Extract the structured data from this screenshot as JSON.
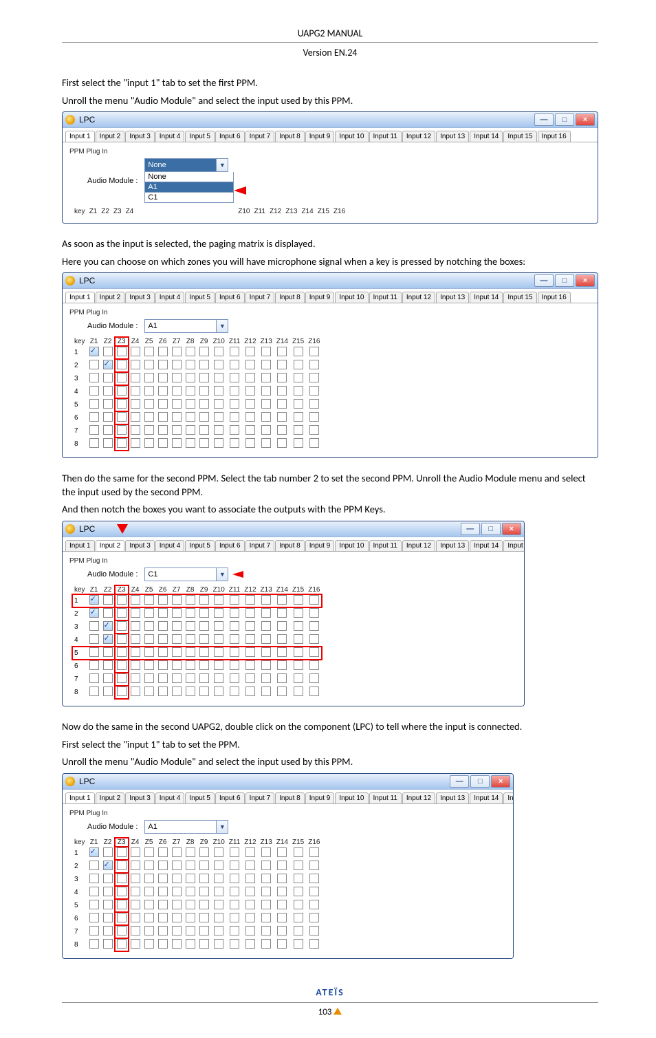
{
  "header": {
    "manual_title": "UAPG2  MANUAL",
    "version": "Version EN.24"
  },
  "intro": {
    "p1": "First select the \"input 1\" tab to set the first PPM.",
    "p2": "Unroll the menu \"Audio Module\" and select the input used by this PPM."
  },
  "lpc": {
    "window_title": "LPC",
    "section_label": "PPM Plug In",
    "audio_module_label": "Audio Module :",
    "combo_none": "None",
    "option_none": "None",
    "option_a1": "A1",
    "option_c1": "C1",
    "combo_a1": "A1",
    "combo_c1": "C1"
  },
  "tabs": [
    "Input 1",
    "Input 2",
    "Input 3",
    "Input 4",
    "Input 5",
    "Input 6",
    "Input 7",
    "Input 8",
    "Input 9",
    "Input 10",
    "Input 11",
    "Input 12",
    "Input 13",
    "Input 14",
    "Input 15",
    "Input 16"
  ],
  "zone_cols_a": [
    "Z1",
    "Z2",
    "Z3",
    "Z4"
  ],
  "zone_cols_b": [
    "Z10",
    "Z11",
    "Z12",
    "Z13",
    "Z14",
    "Z15",
    "Z16"
  ],
  "zone_cols_all": [
    "Z1",
    "Z2",
    "Z3",
    "Z4",
    "Z5",
    "Z6",
    "Z7",
    "Z8",
    "Z9",
    "Z10",
    "Z11",
    "Z12",
    "Z13",
    "Z14",
    "Z15",
    "Z16"
  ],
  "matrix_keys": [
    "1",
    "2",
    "3",
    "4",
    "5",
    "6",
    "7",
    "8"
  ],
  "key_label": "key",
  "matrix2_checks": {
    "1": [
      "Z1"
    ],
    "2": [
      "Z2"
    ]
  },
  "matrix3_checks": {
    "1": [
      "Z1"
    ],
    "2": [
      "Z1"
    ],
    "3": [
      "Z2"
    ],
    "4": [
      "Z2"
    ]
  },
  "matrix4_checks": {
    "1": [
      "Z1"
    ],
    "2": [
      "Z2"
    ]
  },
  "mid_para": {
    "p1": "As soon as the input is selected, the paging matrix is displayed.",
    "p2": "Here you can choose on which zones you will have microphone signal when a key is pressed by notching the boxes:"
  },
  "third_para": {
    "p1": "Then do the same for the second PPM. Select the tab number 2 to set the second PPM. Unroll the Audio Module menu and select the input used by the second PPM.",
    "p2": "And then notch the boxes you want to associate the outputs with the PPM Keys."
  },
  "fourth_para": {
    "p1": "Now do the same in the second UAPG2, double click on the component (LPC) to tell where the input is connected.",
    "p2": "First select the \"input 1\" tab to set the PPM.",
    "p3": "Unroll the menu \"Audio Module\" and select the input used by this PPM."
  },
  "footer": {
    "logo": "ATEÏS",
    "page": "103"
  }
}
